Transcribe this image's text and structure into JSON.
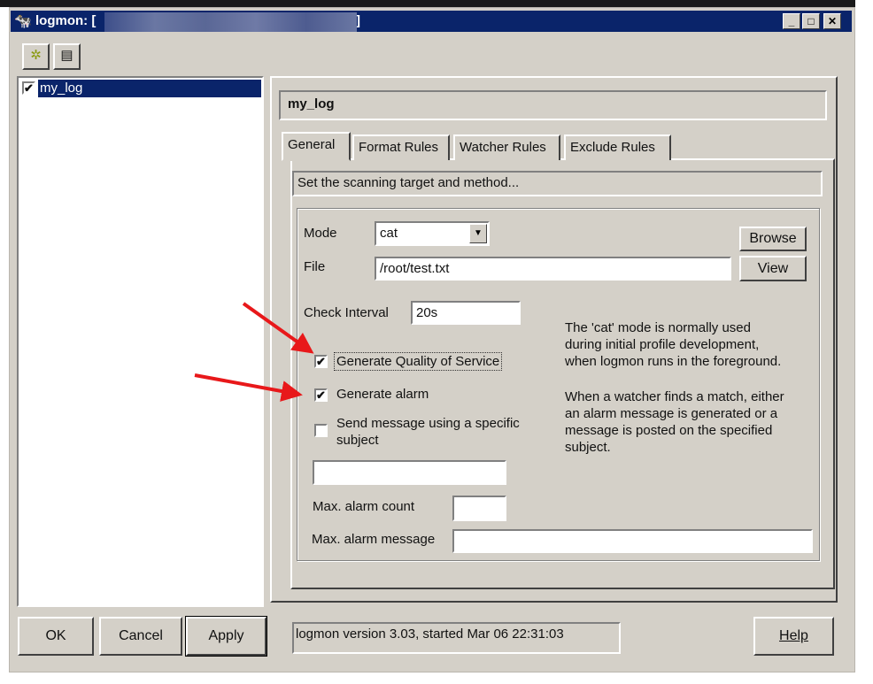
{
  "window": {
    "title": "logmon: [",
    "title_close": "]",
    "app_icon": "logmon-icon",
    "controls": [
      "minimize-icon",
      "maximize-icon",
      "close-icon"
    ]
  },
  "toolbar": {
    "buttons": [
      {
        "icon": "settings-gear-icon"
      },
      {
        "icon": "document-icon"
      }
    ]
  },
  "tree": {
    "items": [
      {
        "label": "my_log",
        "checked": true,
        "selected": true
      }
    ]
  },
  "profile": {
    "name": "my_log"
  },
  "tabs": [
    {
      "label": "General",
      "active": true
    },
    {
      "label": "Format Rules"
    },
    {
      "label": "Watcher Rules"
    },
    {
      "label": "Exclude Rules"
    }
  ],
  "general": {
    "description": "Set the scanning target and method...",
    "mode_label": "Mode",
    "mode_value": "cat",
    "file_label": "File",
    "file_value": "/root/test.txt",
    "browse": "Browse",
    "view": "View",
    "interval_label": "Check Interval",
    "interval_value": "20s",
    "qos_label": "Generate Quality of Service",
    "qos_checked": true,
    "alarm_label": "Generate alarm",
    "alarm_checked": true,
    "send_label_1": "Send message using a specific",
    "send_label_2": "subject",
    "send_checked": false,
    "subject_value": "",
    "max_count_label": "Max. alarm count",
    "max_count_value": "",
    "max_msg_label": "Max. alarm message",
    "max_msg_value": "",
    "help_1": [
      "The 'cat' mode is normally used",
      "during initial profile development,",
      "when logmon runs in the foreground."
    ],
    "help_2": [
      "When a watcher finds a match, either",
      "an alarm message is generated or a",
      "message is posted on the specified",
      "subject."
    ]
  },
  "footer": {
    "ok": "OK",
    "cancel": "Cancel",
    "apply": "Apply",
    "help": "Help",
    "status": "logmon version 3.03, started Mar 06 22:31:03"
  },
  "annotation_color": "#e8181a"
}
